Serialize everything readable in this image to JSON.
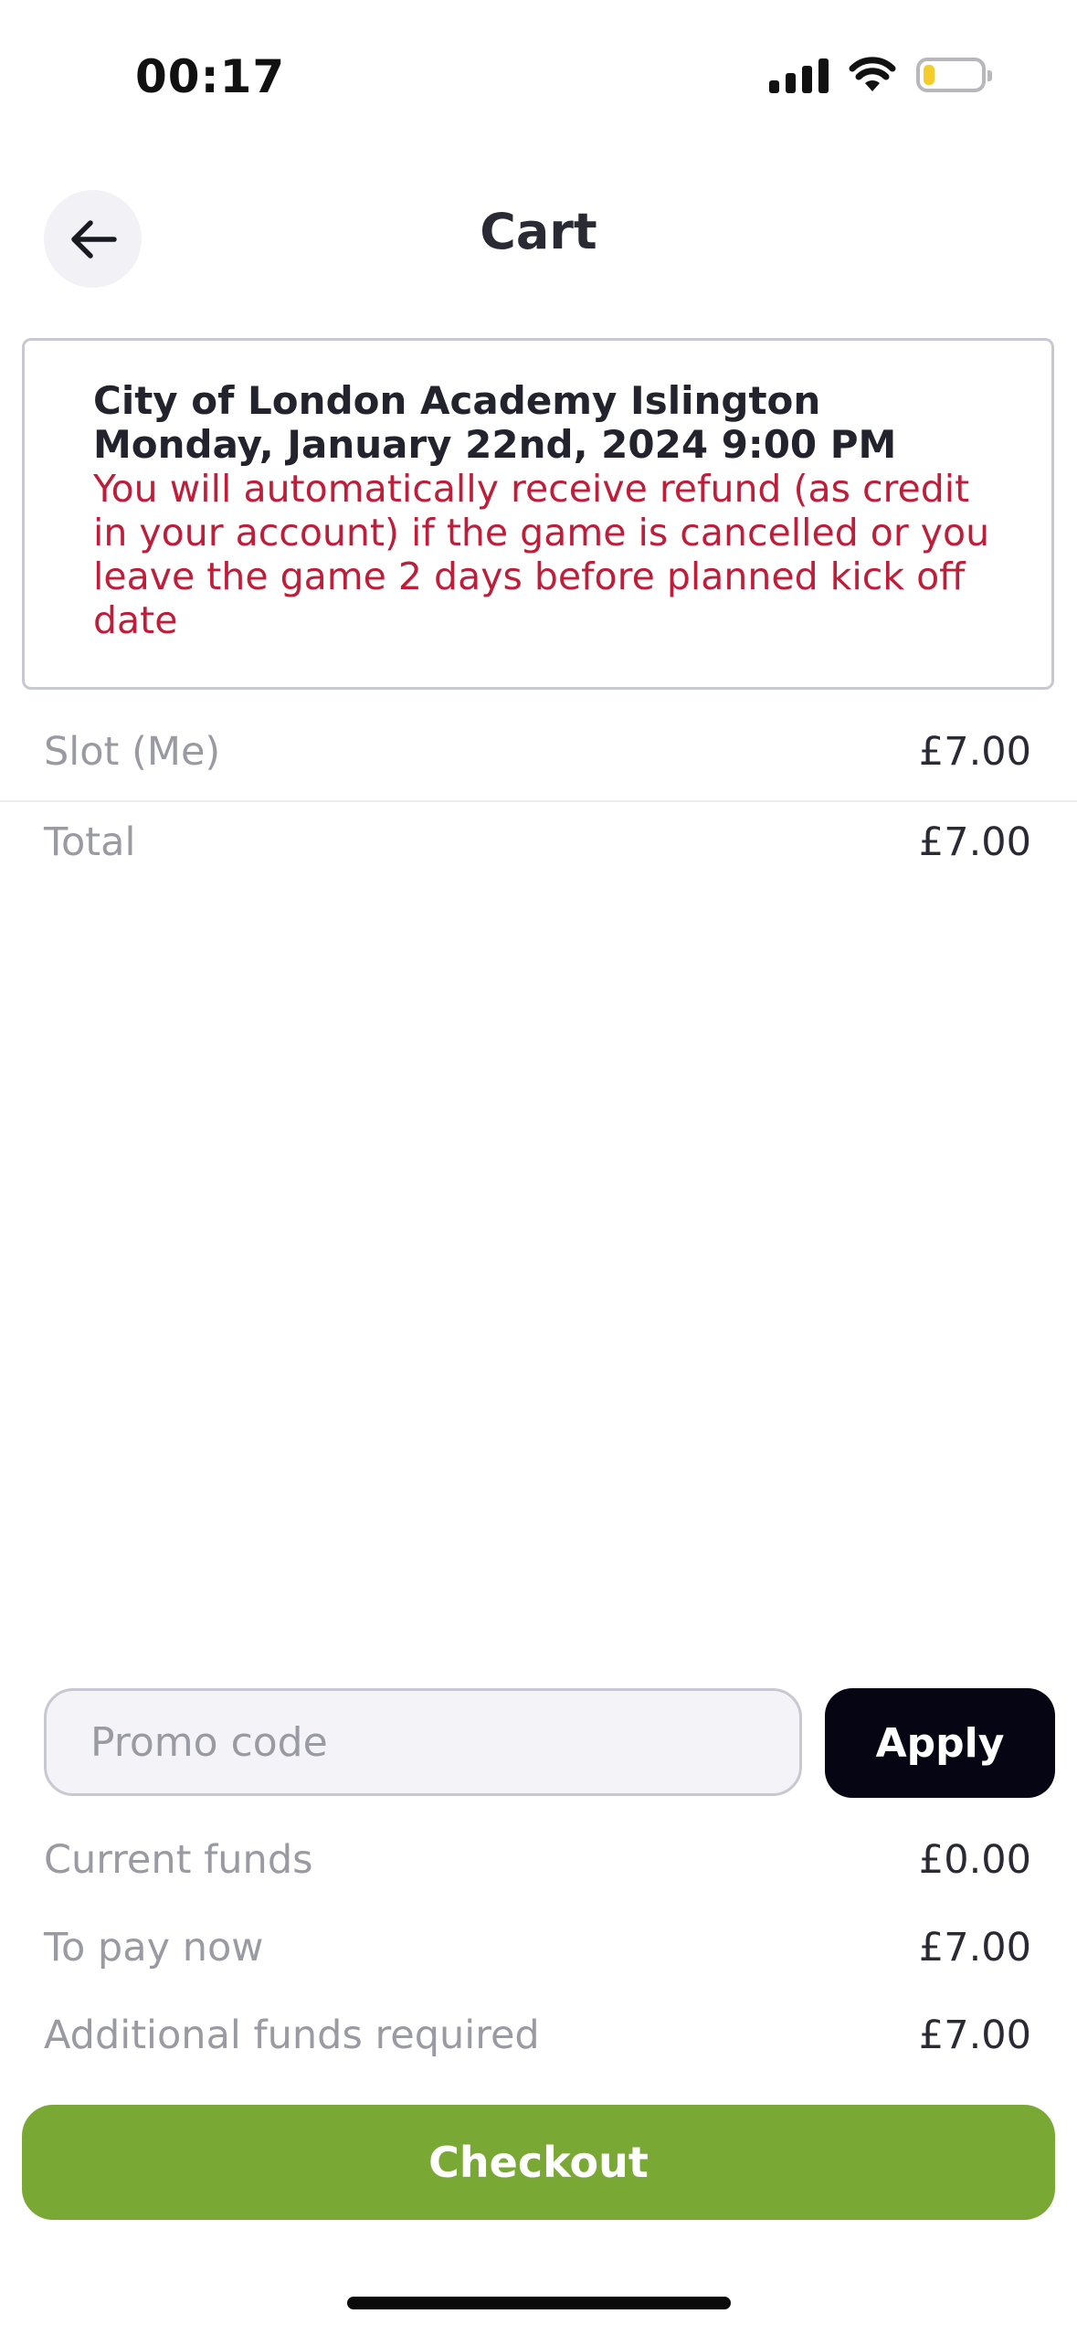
{
  "status_bar": {
    "time": "00:17",
    "icons": [
      "signal-icon",
      "wifi-icon",
      "battery-icon"
    ],
    "battery_level": 0.2,
    "battery_color": "#f4cd2a"
  },
  "header": {
    "back_icon": "arrow-left-icon",
    "title": "Cart"
  },
  "game": {
    "venue": "City of London Academy Islington",
    "datetime": "Monday, January 22nd, 2024 9:00 PM",
    "refund_note": "You will automatically receive refund (as credit in your account) if the game is cancelled or you leave the game 2 days before planned kick off date"
  },
  "items": [
    {
      "label": "Slot (Me)",
      "value": "£7.00"
    },
    {
      "label": "Total",
      "value": "£7.00"
    }
  ],
  "promo": {
    "placeholder": "Promo code",
    "value": "",
    "apply_label": "Apply"
  },
  "summary": [
    {
      "label": "Current funds",
      "value": "£0.00"
    },
    {
      "label": "To pay now",
      "value": "£7.00"
    },
    {
      "label": "Additional funds required",
      "value": "£7.00"
    }
  ],
  "checkout": {
    "label": "Checkout",
    "color": "#7aa834"
  },
  "colors": {
    "warning_text": "#be1e3a",
    "apply_button": "#050514"
  }
}
